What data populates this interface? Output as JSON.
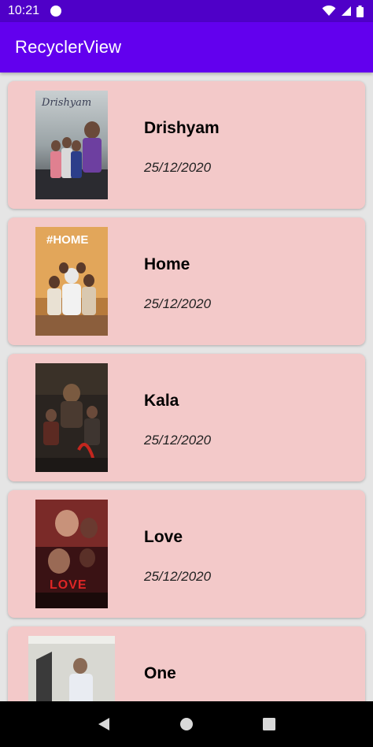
{
  "status_bar": {
    "time": "10:21",
    "icons": [
      "notification-dot-icon",
      "wifi-icon",
      "signal-icon",
      "battery-icon"
    ]
  },
  "app_bar": {
    "title": "RecyclerView",
    "color": "#6200ee"
  },
  "movies": [
    {
      "name": "Drishyam",
      "date": "25/12/2020",
      "poster_title": "Drishyam"
    },
    {
      "name": "Home",
      "date": "25/12/2020",
      "poster_title": "#HOME"
    },
    {
      "name": "Kala",
      "date": "25/12/2020",
      "poster_title": ""
    },
    {
      "name": "Love",
      "date": "25/12/2020",
      "poster_title": "LOVE"
    },
    {
      "name": "One",
      "date": "",
      "poster_title": ""
    }
  ],
  "colors": {
    "card_background": "#f3c9c9",
    "list_background": "#e5e5e5",
    "status_bar": "#4f00c8"
  },
  "nav_bar": {
    "icons": [
      "back-icon",
      "home-icon",
      "recents-icon"
    ]
  }
}
